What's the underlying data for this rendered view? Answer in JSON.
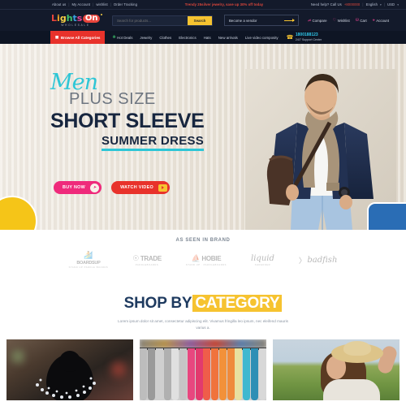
{
  "topbar": {
    "links": [
      "About us",
      "My Account",
      "wishlist",
      "Order Tracking"
    ],
    "promo": "Trendy 25silver jewelry, save up 30% off today",
    "help_label": "Need help? Call Us",
    "phone": "+8000000",
    "language": "English",
    "currency": "USD"
  },
  "header": {
    "logo": {
      "letters": [
        "L",
        "i",
        "g",
        "h",
        "t",
        "s"
      ],
      "badge": "On",
      "tagline": "WHOLESALE"
    },
    "search": {
      "placeholder": "Search for products...",
      "value": "",
      "button_label": "Search"
    },
    "vendor_button": "Become a vendor",
    "links": [
      {
        "label": "Compare",
        "icon": "compare-icon",
        "glyph": "⥄"
      },
      {
        "label": "Wishlist",
        "icon": "heart-icon",
        "glyph": "♡"
      },
      {
        "label": "Cart",
        "icon": "cart-icon",
        "glyph": "⛁"
      },
      {
        "label": "Account",
        "icon": "user-icon",
        "glyph": "⚹"
      }
    ]
  },
  "nav": {
    "browse_label": "Browse All Categories",
    "items": [
      "Hot Deals",
      "Jewelry",
      "Clothes",
      "Electronics",
      "Hats",
      "New arrivals",
      "Live video composity"
    ],
    "phone_number": "1800188123",
    "phone_sub": "24/7 Support Center"
  },
  "hero": {
    "script_line": "Men",
    "line2": "PLUS SIZE",
    "line3": "SHORT SLEEVE",
    "line4": "SUMMER DRESS",
    "buy_button": "BUY NOW",
    "watch_button": "WATCH VIDEO"
  },
  "brands": {
    "title": "AS SEEN IN BRAND",
    "items": [
      {
        "name": "BOARDSUP",
        "sub": "STAND UP PADDLE BOARDS",
        "style": "bold"
      },
      {
        "name": "TRADE",
        "sub": "PADDLEBOARDS",
        "style": "bold"
      },
      {
        "name": "HOBIE",
        "sub": "STAND UP · PADDLEBOARDS",
        "style": "bold"
      },
      {
        "name": "liquid",
        "sub": "SHREDDER",
        "style": "italic"
      },
      {
        "name": "badfish",
        "sub": "",
        "style": "italic"
      }
    ]
  },
  "shop": {
    "title_part1": "SHOP BY",
    "title_part2": "CATEGORY",
    "subtitle": "Lorem ipsum dolor sit amet, consectetur adipiscing elit. Vivamus fringilla leo ipsum, nec eleifend mauris varius a."
  },
  "categories": [
    {
      "name": "jewelry-category-card"
    },
    {
      "name": "clothes-category-card"
    },
    {
      "name": "hats-category-card"
    }
  ],
  "colors": {
    "dark_navy": "#131a2b",
    "nav_navy": "#0e1524",
    "red": "#e8322b",
    "yellow": "#f6c330",
    "pink": "#ef2a7b",
    "cyan": "#2ec6d6",
    "blue": "#2a6db5",
    "heading_navy": "#1e3a5f"
  }
}
